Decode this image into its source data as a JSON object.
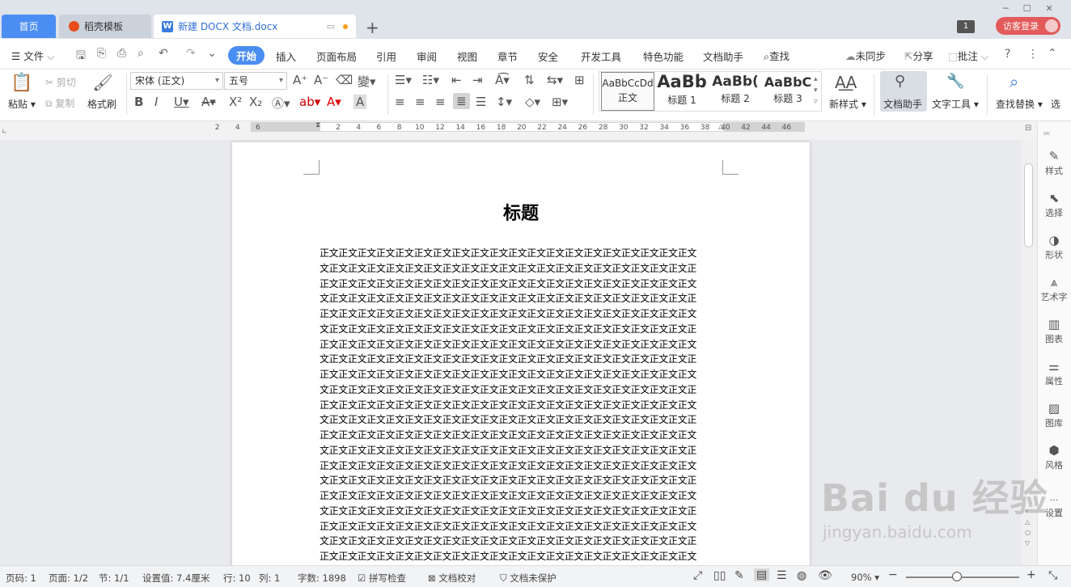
{
  "tabs": {
    "home": "首页",
    "template": "稻壳模板",
    "doc": "新建 DOCX 文档.docx",
    "add": "+"
  },
  "window": {
    "badge": "1",
    "login": "访客登录",
    "min": "─",
    "max": "☐",
    "close": "✕"
  },
  "menu": {
    "file": "文件",
    "items": [
      "开始",
      "插入",
      "页面布局",
      "引用",
      "审阅",
      "视图",
      "章节",
      "安全",
      "开发工具",
      "特色功能",
      "文档助手",
      "查找"
    ],
    "unsynced": "未同步",
    "share": "分享",
    "comment": "批注"
  },
  "ribbon": {
    "paste": "粘贴",
    "cut": "剪切",
    "copy": "复制",
    "format_painter": "格式刷",
    "font": "宋体 (正文)",
    "size": "五号",
    "styles": [
      {
        "preview": "AaBbCcDd",
        "name": "正文"
      },
      {
        "preview": "AaBb",
        "name": "标题 1"
      },
      {
        "preview": "AaBb(",
        "name": "标题 2"
      },
      {
        "preview": "AaBbC",
        "name": "标题 3"
      }
    ],
    "new_style": "新样式",
    "doc_assistant": "文档助手",
    "text_tools": "文字工具",
    "find_replace": "查找替换",
    "select": "选"
  },
  "ruler": [
    "6",
    "4",
    "2",
    "2",
    "4",
    "6",
    "8",
    "10",
    "12",
    "14",
    "16",
    "18",
    "20",
    "22",
    "24",
    "26",
    "28",
    "30",
    "32",
    "34",
    "36",
    "38",
    "40",
    "42",
    "44",
    "46"
  ],
  "document": {
    "title": "标题",
    "line_a": "正文正文正文正文正文正文正文正文正文正文正文正文正文正文正文正文正文正文正文正文",
    "line_b": "文正文正文正文正文正文正文正文正文正文正文正文正文正文正文正文正文正文正文正文正"
  },
  "side_panel": [
    "样式",
    "选择",
    "形状",
    "艺术字",
    "图表",
    "属性",
    "图库",
    "风格",
    "设置"
  ],
  "status": {
    "page_code": "页码: 1",
    "page": "页面: 1/2",
    "section": "节: 1/1",
    "setting": "设置值: 7.4厘米",
    "row": "行: 10",
    "col": "列: 1",
    "words": "字数: 1898",
    "spell": "拼写检查",
    "proof": "文档校对",
    "protect": "文档未保护",
    "zoom": "90%"
  },
  "watermark": {
    "brand": "Bai du 经验",
    "url": "jingyan.baidu.com"
  }
}
